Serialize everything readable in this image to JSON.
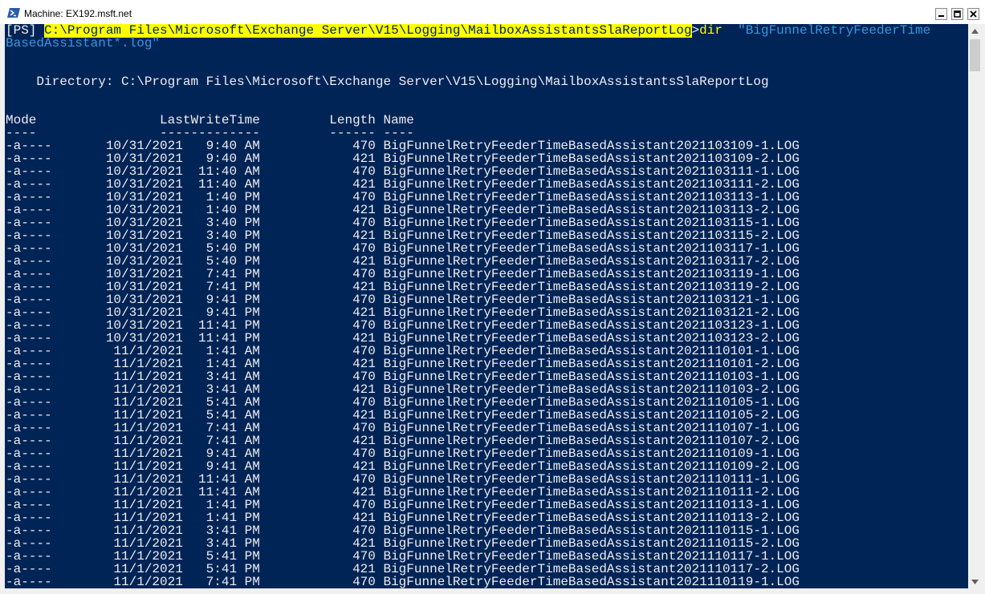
{
  "window": {
    "title": "Machine: EX192.msft.net",
    "icon": "powershell-icon",
    "buttons": {
      "minimize": "minimize-icon",
      "maximize": "maximize-icon",
      "close": "close-icon"
    }
  },
  "colors": {
    "console_bg": "#012456",
    "console_fg": "#eeedf0",
    "highlight": "#ffff00",
    "string": "#3a96dd"
  },
  "console": {
    "prompt_prefix": "[PS] ",
    "prompt_path": "C:\\Program Files\\Microsoft\\Exchange Server\\V15\\Logging\\MailboxAssistantsSlaReportLog",
    "prompt_gt": ">",
    "command": "dir",
    "arg_line1": "  \"BigFunnelRetryFeederTime",
    "arg_line2": "BasedAssistant*.log\"",
    "directory_line": "    Directory: C:\\Program Files\\Microsoft\\Exchange Server\\V15\\Logging\\MailboxAssistantsSlaReportLog",
    "header_line": "Mode                LastWriteTime         Length Name",
    "underline_line": "----                -------------         ------ ----",
    "rows": [
      "-a----       10/31/2021   9:40 AM            470 BigFunnelRetryFeederTimeBasedAssistant2021103109-1.LOG",
      "-a----       10/31/2021   9:40 AM            421 BigFunnelRetryFeederTimeBasedAssistant2021103109-2.LOG",
      "-a----       10/31/2021  11:40 AM            470 BigFunnelRetryFeederTimeBasedAssistant2021103111-1.LOG",
      "-a----       10/31/2021  11:40 AM            421 BigFunnelRetryFeederTimeBasedAssistant2021103111-2.LOG",
      "-a----       10/31/2021   1:40 PM            470 BigFunnelRetryFeederTimeBasedAssistant2021103113-1.LOG",
      "-a----       10/31/2021   1:40 PM            421 BigFunnelRetryFeederTimeBasedAssistant2021103113-2.LOG",
      "-a----       10/31/2021   3:40 PM            470 BigFunnelRetryFeederTimeBasedAssistant2021103115-1.LOG",
      "-a----       10/31/2021   3:40 PM            421 BigFunnelRetryFeederTimeBasedAssistant2021103115-2.LOG",
      "-a----       10/31/2021   5:40 PM            470 BigFunnelRetryFeederTimeBasedAssistant2021103117-1.LOG",
      "-a----       10/31/2021   5:40 PM            421 BigFunnelRetryFeederTimeBasedAssistant2021103117-2.LOG",
      "-a----       10/31/2021   7:41 PM            470 BigFunnelRetryFeederTimeBasedAssistant2021103119-1.LOG",
      "-a----       10/31/2021   7:41 PM            421 BigFunnelRetryFeederTimeBasedAssistant2021103119-2.LOG",
      "-a----       10/31/2021   9:41 PM            470 BigFunnelRetryFeederTimeBasedAssistant2021103121-1.LOG",
      "-a----       10/31/2021   9:41 PM            421 BigFunnelRetryFeederTimeBasedAssistant2021103121-2.LOG",
      "-a----       10/31/2021  11:41 PM            470 BigFunnelRetryFeederTimeBasedAssistant2021103123-1.LOG",
      "-a----       10/31/2021  11:41 PM            421 BigFunnelRetryFeederTimeBasedAssistant2021103123-2.LOG",
      "-a----        11/1/2021   1:41 AM            470 BigFunnelRetryFeederTimeBasedAssistant2021110101-1.LOG",
      "-a----        11/1/2021   1:41 AM            421 BigFunnelRetryFeederTimeBasedAssistant2021110101-2.LOG",
      "-a----        11/1/2021   3:41 AM            470 BigFunnelRetryFeederTimeBasedAssistant2021110103-1.LOG",
      "-a----        11/1/2021   3:41 AM            421 BigFunnelRetryFeederTimeBasedAssistant2021110103-2.LOG",
      "-a----        11/1/2021   5:41 AM            470 BigFunnelRetryFeederTimeBasedAssistant2021110105-1.LOG",
      "-a----        11/1/2021   5:41 AM            421 BigFunnelRetryFeederTimeBasedAssistant2021110105-2.LOG",
      "-a----        11/1/2021   7:41 AM            470 BigFunnelRetryFeederTimeBasedAssistant2021110107-1.LOG",
      "-a----        11/1/2021   7:41 AM            421 BigFunnelRetryFeederTimeBasedAssistant2021110107-2.LOG",
      "-a----        11/1/2021   9:41 AM            470 BigFunnelRetryFeederTimeBasedAssistant2021110109-1.LOG",
      "-a----        11/1/2021   9:41 AM            421 BigFunnelRetryFeederTimeBasedAssistant2021110109-2.LOG",
      "-a----        11/1/2021  11:41 AM            470 BigFunnelRetryFeederTimeBasedAssistant2021110111-1.LOG",
      "-a----        11/1/2021  11:41 AM            421 BigFunnelRetryFeederTimeBasedAssistant2021110111-2.LOG",
      "-a----        11/1/2021   1:41 PM            470 BigFunnelRetryFeederTimeBasedAssistant2021110113-1.LOG",
      "-a----        11/1/2021   1:41 PM            421 BigFunnelRetryFeederTimeBasedAssistant2021110113-2.LOG",
      "-a----        11/1/2021   3:41 PM            470 BigFunnelRetryFeederTimeBasedAssistant2021110115-1.LOG",
      "-a----        11/1/2021   3:41 PM            421 BigFunnelRetryFeederTimeBasedAssistant2021110115-2.LOG",
      "-a----        11/1/2021   5:41 PM            470 BigFunnelRetryFeederTimeBasedAssistant2021110117-1.LOG",
      "-a----        11/1/2021   5:41 PM            421 BigFunnelRetryFeederTimeBasedAssistant2021110117-2.LOG",
      "-a----        11/1/2021   7:41 PM            470 BigFunnelRetryFeederTimeBasedAssistant2021110119-1.LOG"
    ]
  },
  "scrollbar": {
    "up": "scroll-up-arrow-icon",
    "down": "scroll-down-arrow-icon"
  }
}
